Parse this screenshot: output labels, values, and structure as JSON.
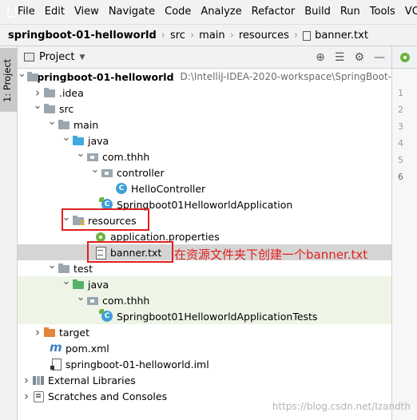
{
  "menubar": {
    "items": [
      "File",
      "Edit",
      "View",
      "Navigate",
      "Code",
      "Analyze",
      "Refactor",
      "Build",
      "Run",
      "Tools",
      "VCS"
    ]
  },
  "breadcrumbs": {
    "root": "springboot-01-helloworld",
    "items": [
      "src",
      "main",
      "resources",
      "banner.txt"
    ]
  },
  "tool_stripe": {
    "project_tab": "1: Project"
  },
  "panel": {
    "title": "Project"
  },
  "tree": {
    "root_label": "springboot-01-helloworld",
    "root_path": "D:\\IntelliJ-IDEA-2020-workspace\\SpringBoot-",
    "idea": ".idea",
    "src": "src",
    "main": "main",
    "java_main": "java",
    "pkg_main": "com.thhh",
    "controller": "controller",
    "hello_controller": "HelloController",
    "app_class": "Springboot01HelloworldApplication",
    "resources": "resources",
    "app_props": "application.properties",
    "banner": "banner.txt",
    "test": "test",
    "java_test": "java",
    "pkg_test": "com.thhh",
    "test_class": "Springboot01HelloworldApplicationTests",
    "target": "target",
    "pom": "pom.xml",
    "iml": "springboot-01-helloworld.iml",
    "external_libs": "External Libraries",
    "scratches": "Scratches and Consoles"
  },
  "annotation": {
    "note": "在资源文件夹下创建一个banner.txt",
    "color": "#e0201b"
  },
  "editor": {
    "line_numbers": [
      "1",
      "2",
      "3",
      "4",
      "5",
      "6"
    ]
  },
  "watermark": "https://blog.csdn.net/Izandth",
  "colors": {
    "selected_row": "#d5d5d5",
    "test_tint": "#eef5e6",
    "source_folder": "#40a9e0",
    "test_folder": "#58b368",
    "target_folder": "#e5853a"
  }
}
